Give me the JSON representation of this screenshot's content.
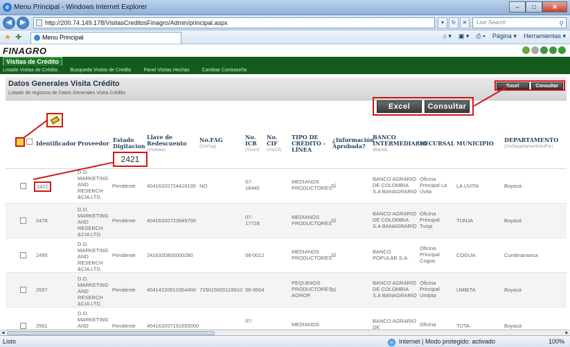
{
  "window": {
    "title": "Menu Principal - Windows Internet Explorer",
    "min": "–",
    "max": "□",
    "close": "✕"
  },
  "addressbar": {
    "url": "http://200.74.149.178/VisitasCreditosFinagro/Admin/principal.aspx",
    "search_placeholder": "Live Search"
  },
  "tab": {
    "label": "Menu Principal"
  },
  "commandbar": {
    "page": "Página ▾",
    "tools": "Herramientas ▾"
  },
  "app": {
    "logo": "FINAGRO",
    "main_tab": "Visitas de Crédito",
    "submenu": [
      "Listado Visitas de Crédito",
      "Busqueda Visitas de Credito",
      "Panel Visitas Hechas",
      "Cambiar Contraseña"
    ]
  },
  "section": {
    "title": "Datos Generales Visita Crédito",
    "subtitle": "Listado de registros de Datos Generales Visita Crédito",
    "excel_label": "Excel",
    "consultar_label": "Consultar"
  },
  "callout": "2421",
  "columns": {
    "identificador": "Identificador",
    "proveedor": "Proveedor",
    "estado": "Estado Digitacion",
    "llave": "Llave de Redescuento",
    "llave_sub": "(VisIlave)",
    "nofag": "No.FAG",
    "nofag_sub": "(VisFag)",
    "icr": "No. ICR",
    "icr_sub": "(VisIcr)",
    "cif": "No. CIF",
    "cif_sub": "(VisCif)",
    "tipo": "TIPO DE CRÉDITO - LÍNEA",
    "info": "¿Información Aprobada?",
    "banco": "BANCO INTERMEDIARIO",
    "banco_sub": "(BanId)",
    "sucursal": "SUCURSAL",
    "municipio": "MUNICIPIO",
    "depto": "DEPARTAMENTO",
    "depto_sub": "(VisDepartamentoInfFin)"
  },
  "rows": [
    {
      "id": "2421",
      "proveedor": "D.O. MARKETING AND RESERCH &CIA LTD.",
      "estado": "Pendiente",
      "llave": "40416320724416100",
      "fag": "NO",
      "icr": "07-18445",
      "cif": "",
      "tipo": "MEDIANOS PRODUCTORES",
      "info": "SÍ",
      "banco": "BANCO AGRARIO DE COLOMBIA S.A BANAGRARIO",
      "sucursal": "Oficina Principal La Uvita",
      "municipio": "LA UVITA",
      "depto": "Boyacá"
    },
    {
      "id": "2478",
      "proveedor": "D.O. MARKETING AND RESERCH &CIA LTD.",
      "estado": "Pendiente",
      "llave": "40416320723949700",
      "fag": "",
      "icr": "07-17728",
      "cif": "",
      "tipo": "MEDIANOS PRODUCTORES",
      "info": "SÍ",
      "banco": "BANCO AGRARIO DE COLOMBIA S.A BANAGRARIO",
      "sucursal": "Oficina Principal Tunja",
      "municipio": "TUNJA",
      "depto": "Boyacá"
    },
    {
      "id": "2495",
      "proveedor": "D.O. MARKETING AND RESERCH &CIA LTD.",
      "estado": "Pendiente",
      "llave": "2416320800000280",
      "fag": "",
      "icr": "08-0012",
      "cif": "",
      "tipo": "MEDIANOS PRODUCTORES",
      "info": "SÍ",
      "banco": "BANCO POPULAR S.A.",
      "sucursal": "Oficina Principal Cogua",
      "municipio": "COGUA",
      "depto": "Cundinamarca"
    },
    {
      "id": "2557",
      "proveedor": "D.O. MARKETING AND RESERCH &CIA LTD.",
      "estado": "Pendiente",
      "llave": "40414220810354400",
      "fag": "725015920119610",
      "icr": "08-0504",
      "cif": "",
      "tipo": "PEQUE#OS PRODUCTORES AGROP.",
      "info": "SÍ",
      "banco": "BANCO AGRARIO DE COLOMBIA S.A BANAGRARIO",
      "sucursal": "Oficina Principal Umbita",
      "municipio": "UMBITA",
      "depto": "Boyacá"
    },
    {
      "id": "2561",
      "proveedor": "D.O. MARKETING AND",
      "estado": "Pendiente",
      "llave": "404163207191655000",
      "fag": "",
      "icr": "07-",
      "cif": "",
      "tipo": "MEDIANOS",
      "info": "",
      "banco": "BANCO AGRARIO DE",
      "sucursal": "Oficina",
      "municipio": "TUTA",
      "depto": "Boyacá"
    }
  ],
  "status": {
    "left": "Listo",
    "zone": "Internet | Modo protegido: activado",
    "zoom": "100%"
  }
}
